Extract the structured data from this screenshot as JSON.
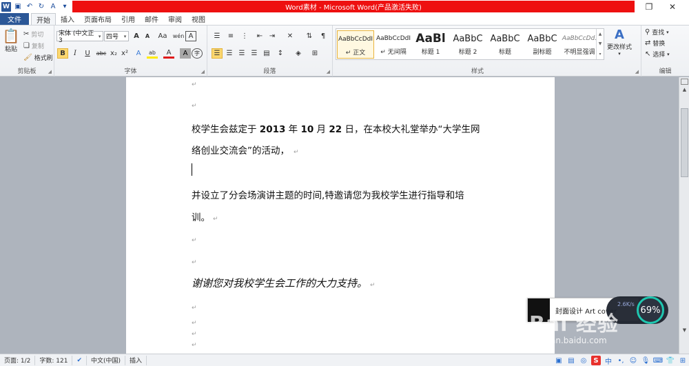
{
  "window": {
    "title": "Word素材 - Microsoft Word(产品激活失败)",
    "restore_icon": "restore-icon",
    "close_icon": "close-icon"
  },
  "tabs": [
    {
      "label": "文件"
    },
    {
      "label": "开始"
    },
    {
      "label": "插入"
    },
    {
      "label": "页面布局"
    },
    {
      "label": "引用"
    },
    {
      "label": "邮件"
    },
    {
      "label": "审阅"
    },
    {
      "label": "视图"
    }
  ],
  "clipboard": {
    "paste": "粘贴",
    "cut": "剪切",
    "copy": "复制",
    "format_painter": "格式刷",
    "group_label": "剪贴板"
  },
  "font": {
    "name": "宋体 (中文正3",
    "size": "四号",
    "group_label": "字体",
    "grow": "A",
    "shrink": "A",
    "case": "Aa",
    "pinyin": "wén",
    "border_char": "A",
    "bold": "B",
    "italic": "I",
    "underline": "U",
    "strike": "abc",
    "subscript": "x₂",
    "superscript": "x²",
    "effects": "A",
    "highlight": "ab",
    "color": "A",
    "shading": "A",
    "enclose": "字"
  },
  "paragraph": {
    "group_label": "段落"
  },
  "styles": {
    "group_label": "样式",
    "change_styles": "更改样式",
    "items": [
      {
        "sample": "AaBbCcDdI",
        "name": "↵ 正文"
      },
      {
        "sample": "AaBbCcDdI",
        "name": "↵ 无间隔"
      },
      {
        "sample": "AaBl",
        "name": "标题 1"
      },
      {
        "sample": "AaBbC",
        "name": "标题 2"
      },
      {
        "sample": "AaBbC",
        "name": "标题"
      },
      {
        "sample": "AaBbC",
        "name": "副标题"
      },
      {
        "sample": "AaBbCcDd.",
        "name": "不明显强调"
      }
    ]
  },
  "editing": {
    "find": "查找",
    "replace": "替换",
    "select": "选择",
    "group_label": "编辑"
  },
  "document": {
    "line1": {
      "t1": "校学生会兹定于 ",
      "b1": "2013",
      "t2": " 年 ",
      "b2": "10",
      "t3": " 月 ",
      "b3": "22",
      "t4": " 日，在本校大礼堂举办“大学生网"
    },
    "line2": "络创业交流会”的活动，",
    "line3": "并设立了分会场演讲主题的时间,特邀请您为我校学生进行指导和培",
    "line4": "训。",
    "line5": "谢谢您对我校学生会工作的大力支持。",
    "para_mark": "↵"
  },
  "popup": {
    "text": "封面设计 Art cover",
    "speed": "2.6K/s",
    "percent": "69%"
  },
  "watermark": {
    "logo": "Bai 经验",
    "url": "jingyan.baidu.com"
  },
  "status": {
    "page": "页面: 1/2",
    "words": "字数: 121",
    "language": "中文(中国)",
    "mode": "插入",
    "ime": "中"
  }
}
